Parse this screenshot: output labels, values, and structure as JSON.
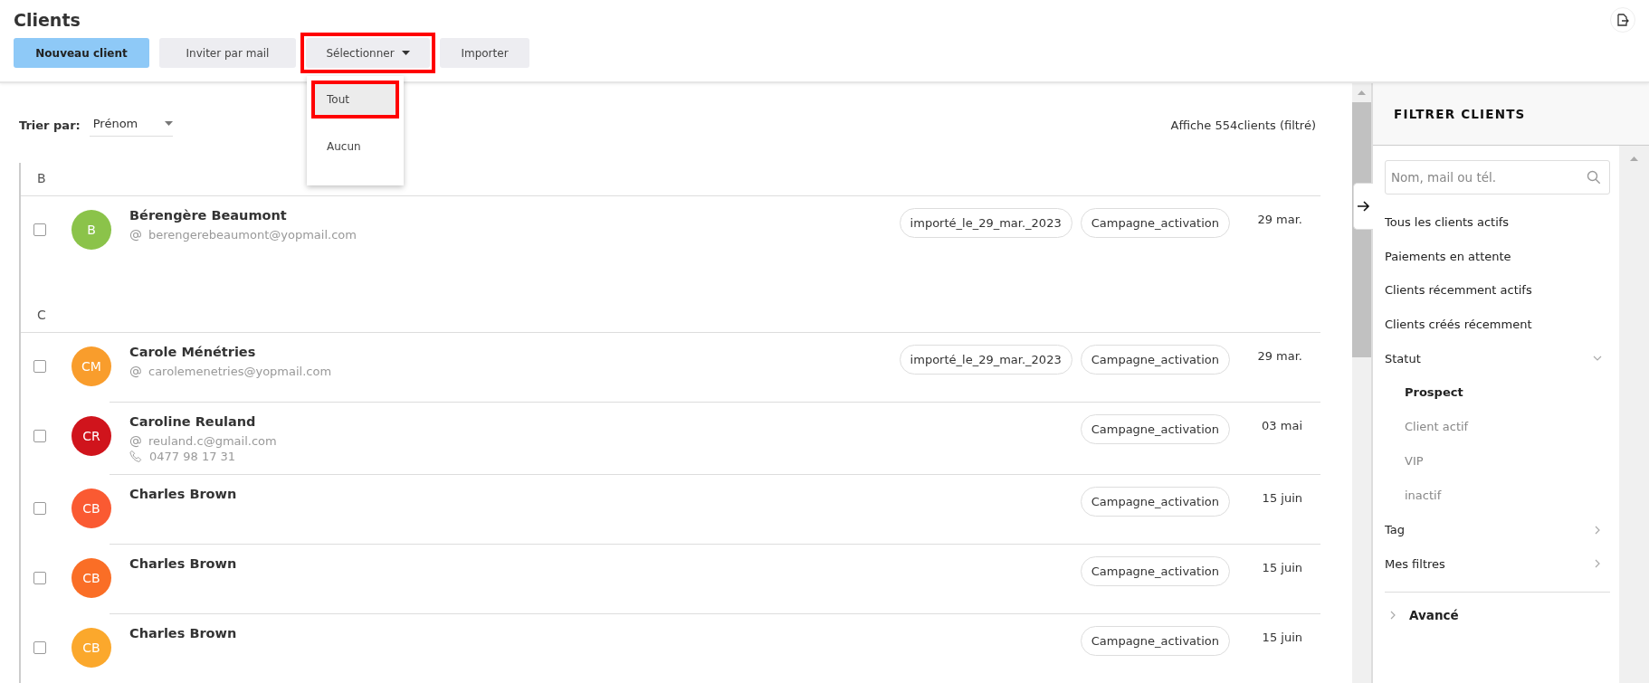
{
  "page": {
    "title": "Clients"
  },
  "toolbar": [
    {
      "label": "Nouveau client",
      "kind": "primary",
      "highlighted": false
    },
    {
      "label": "Inviter par mail",
      "kind": "secondary",
      "highlighted": false
    },
    {
      "label": "Sélectionner",
      "kind": "dropdown",
      "highlighted": true
    },
    {
      "label": "Importer",
      "kind": "secondary",
      "highlighted": false
    }
  ],
  "select_menu": {
    "items": [
      {
        "label": "Tout",
        "selected": true,
        "highlighted": true
      },
      {
        "label": "Aucun",
        "selected": false,
        "highlighted": false
      }
    ]
  },
  "sort": {
    "label": "Trier par:",
    "value": "Prénom"
  },
  "count": "Affiche 554clients (filtré)",
  "sections": [
    {
      "letter": "B",
      "clients": [
        {
          "initials": "B",
          "name": "Bérengère Beaumont",
          "color": "#8bc34a",
          "email": "berengerebeaumont@yopmail.com",
          "tags": [
            "importé_le_29_mar._2023",
            "Campagne_activation"
          ],
          "date": "29 mar.",
          "checked": false
        }
      ]
    },
    {
      "letter": "C",
      "clients": [
        {
          "initials": "CM",
          "name": "Carole Ménétries",
          "color": "#f99d2c",
          "email": "carolemenetries@yopmail.com",
          "tags": [
            "importé_le_29_mar._2023",
            "Campagne_activation"
          ],
          "date": "29 mar.",
          "checked": false
        },
        {
          "initials": "CR",
          "name": "Caroline Reuland",
          "color": "#d0141c",
          "email": "reuland.c@gmail.com",
          "phone": "0477 98 17 31",
          "tags": [
            "Campagne_activation"
          ],
          "date": "03 mai",
          "checked": false
        },
        {
          "initials": "CB",
          "name": "Charles Brown",
          "color": "#fa5a32",
          "tags": [
            "Campagne_activation"
          ],
          "date": "15 juin",
          "checked": false
        },
        {
          "initials": "CB",
          "name": "Charles Brown",
          "color": "#fa6e26",
          "tags": [
            "Campagne_activation"
          ],
          "date": "15 juin",
          "checked": false
        },
        {
          "initials": "CB",
          "name": "Charles Brown",
          "color": "#fba82c",
          "tags": [
            "Campagne_activation"
          ],
          "date": "15 juin",
          "checked": false
        }
      ]
    }
  ],
  "filter_panel": {
    "title": "FILTRER CLIENTS",
    "search": {
      "placeholder": "Nom, mail ou tél."
    },
    "items": [
      {
        "label": "Tous les clients actifs",
        "kind": "link"
      },
      {
        "label": "Paiements en attente",
        "kind": "link"
      },
      {
        "label": "Clients récemment actifs",
        "kind": "link"
      },
      {
        "label": "Clients créés récemment",
        "kind": "link"
      },
      {
        "label": "Statut",
        "kind": "group",
        "expanded": true,
        "children": [
          {
            "label": "Prospect",
            "selected": true
          },
          {
            "label": "Client actif",
            "selected": false
          },
          {
            "label": "VIP",
            "selected": false
          },
          {
            "label": "inactif",
            "selected": false
          }
        ]
      },
      {
        "label": "Tag",
        "kind": "group",
        "expanded": false
      },
      {
        "label": "Mes filtres",
        "kind": "group",
        "expanded": false
      }
    ],
    "advanced": {
      "label": "Avancé",
      "expanded": false
    }
  }
}
